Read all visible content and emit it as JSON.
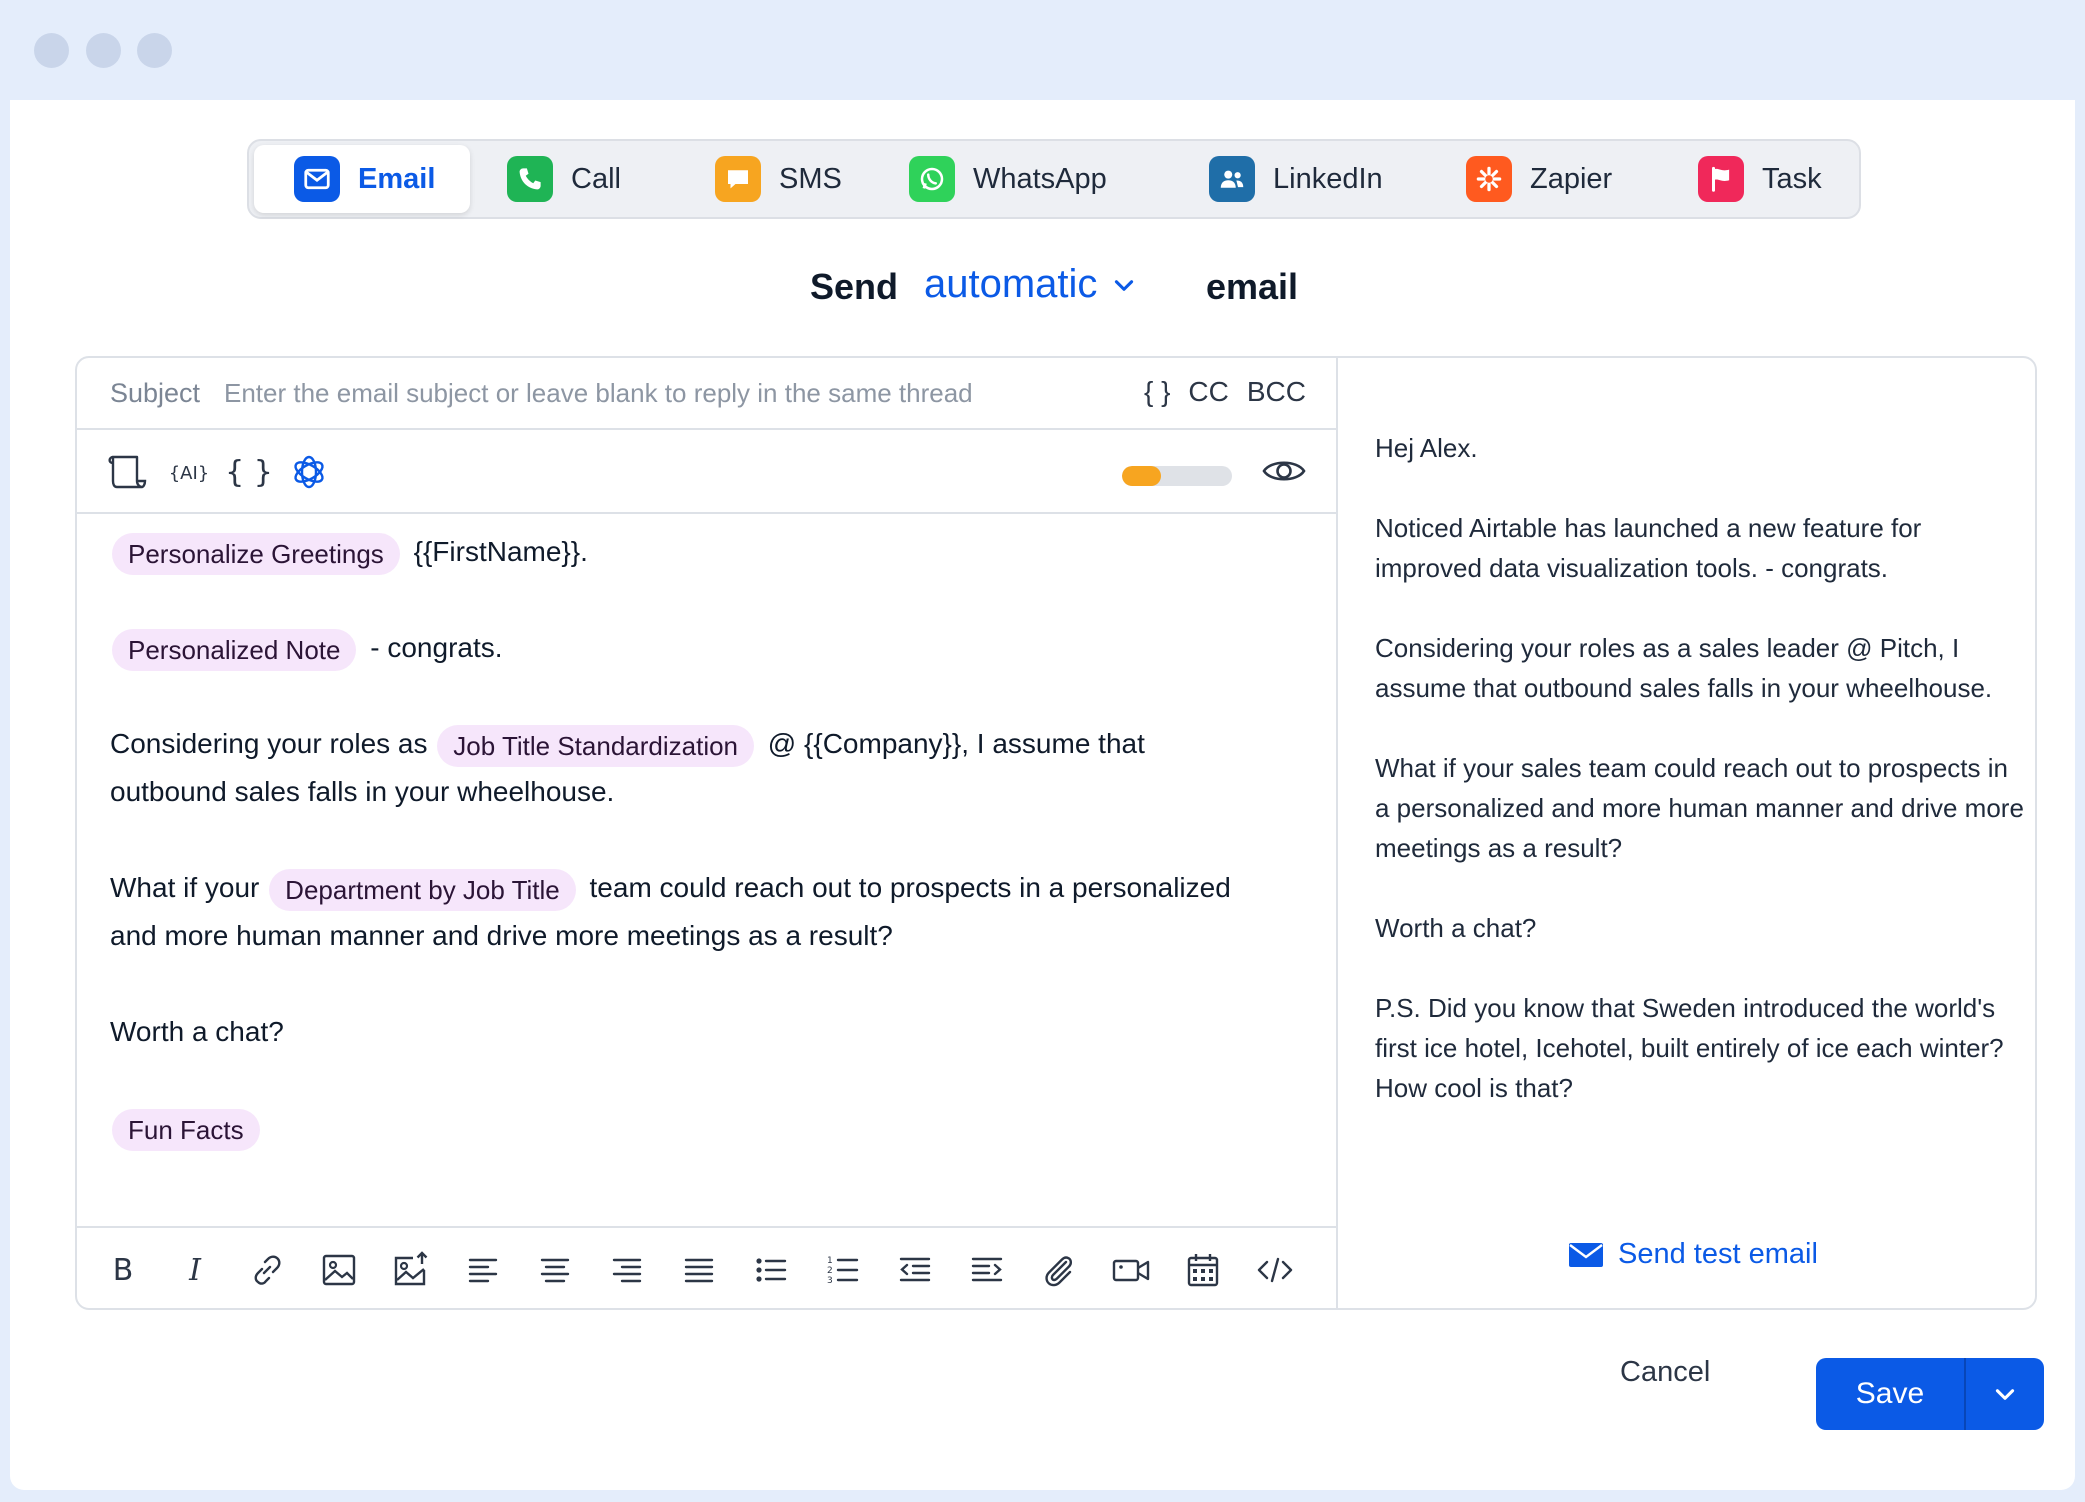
{
  "colors": {
    "accent": "#0b5ae6",
    "chip_bg": "#f6e6fb",
    "progress": "#f7a520"
  },
  "tabs": [
    {
      "label": "Email",
      "icon": "mail-icon",
      "color": "#0b5ae6",
      "active": true
    },
    {
      "label": "Call",
      "icon": "phone-icon",
      "color": "#1fb455"
    },
    {
      "label": "SMS",
      "icon": "message-icon",
      "color": "#f7a520"
    },
    {
      "label": "WhatsApp",
      "icon": "whatsapp-icon",
      "color": "#2fd25a"
    },
    {
      "label": "LinkedIn",
      "icon": "users-icon",
      "color": "#1f6ea8"
    },
    {
      "label": "Zapier",
      "icon": "zapier-icon",
      "color": "#ff5a1f"
    },
    {
      "label": "Task",
      "icon": "flag-icon",
      "color": "#f0285a"
    }
  ],
  "send_line": {
    "prefix": "Send",
    "mode": "automatic",
    "suffix": "email"
  },
  "subject": {
    "label": "Subject",
    "placeholder": "Enter the email subject or leave blank to reply in the same thread",
    "braces": "{ }",
    "cc": "CC",
    "bcc": "BCC"
  },
  "quality_meter": 0.35,
  "body": {
    "p1": {
      "chip": "Personalize Greetings",
      "text": "{{FirstName}}."
    },
    "p2": {
      "chip": "Personalized Note",
      "text": "- congrats."
    },
    "p3": {
      "before": "Considering your roles as",
      "chip": "Job Title Standardization",
      "after": "@ {{Company}}, I assume that",
      "line2": "outbound sales falls in your wheelhouse."
    },
    "p4": {
      "before": "What if your",
      "chip": "Department by Job Title",
      "after": "team could reach out to prospects in a personalized",
      "line2": "and more human manner and drive more meetings as a result?"
    },
    "p5": {
      "text": "Worth a chat?"
    },
    "p6": {
      "chip": "Fun Facts"
    }
  },
  "preview": {
    "paragraphs": [
      "Hej Alex.",
      "Noticed Airtable has launched a new feature for improved data visualization tools. - congrats.",
      "Considering your roles as a sales leader @ Pitch, I assume that outbound sales falls in your wheelhouse.",
      "What if your sales team could reach out to prospects in a personalized and more human manner and drive more meetings as a result?",
      "Worth a chat?",
      "P.S. Did you know that Sweden introduced the world's first ice hotel, Icehotel, built entirely of ice each winter? How cool is that?"
    ],
    "test_label": "Send test email"
  },
  "footer": {
    "cancel": "Cancel",
    "save": "Save"
  }
}
